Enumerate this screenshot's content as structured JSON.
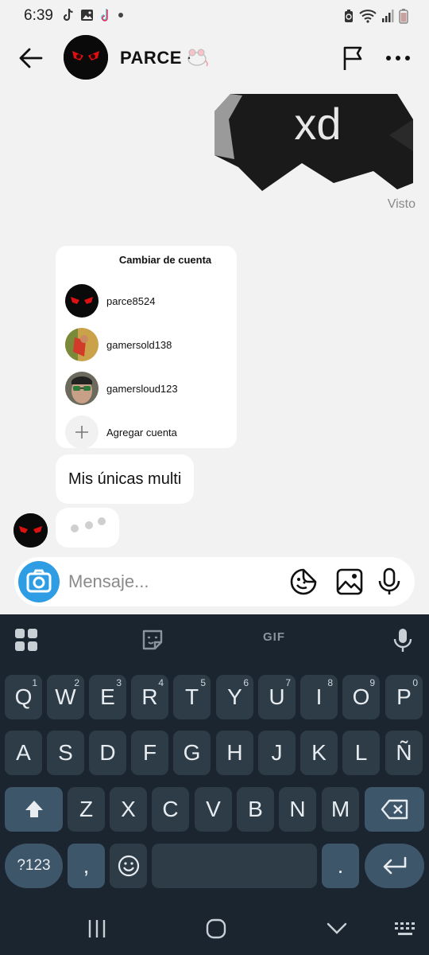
{
  "status_bar": {
    "time": "6:39"
  },
  "header": {
    "title": "PARCE",
    "title_emoji": "🐁"
  },
  "chat": {
    "sticker_text": "xd",
    "seen_label": "Visto",
    "account_card": {
      "title": "Cambiar de cuenta",
      "accounts": [
        {
          "username": "parce8524"
        },
        {
          "username": "gamersold138"
        },
        {
          "username": "gamersloud123"
        }
      ],
      "add_label": "Agregar cuenta"
    },
    "incoming_message": "Mis únicas multi"
  },
  "composer": {
    "placeholder": "Mensaje..."
  },
  "keyboard": {
    "gif_label": "GIF",
    "row1": [
      {
        "k": "Q",
        "s": "1"
      },
      {
        "k": "W",
        "s": "2"
      },
      {
        "k": "E",
        "s": "3"
      },
      {
        "k": "R",
        "s": "4"
      },
      {
        "k": "T",
        "s": "5"
      },
      {
        "k": "Y",
        "s": "6"
      },
      {
        "k": "U",
        "s": "7"
      },
      {
        "k": "I",
        "s": "8"
      },
      {
        "k": "O",
        "s": "9"
      },
      {
        "k": "P",
        "s": "0"
      }
    ],
    "row2": [
      "A",
      "S",
      "D",
      "F",
      "G",
      "H",
      "J",
      "K",
      "L",
      "Ñ"
    ],
    "row3": [
      "Z",
      "X",
      "C",
      "V",
      "B",
      "N",
      "M"
    ],
    "symbols_label": "?123",
    "comma_label": ",",
    "period_label": "."
  },
  "colors": {
    "accent": "#2e9de4",
    "keyboard_bg": "#1b2530",
    "key_bg": "#2e3c48",
    "mod_key_bg": "#3e5669"
  }
}
